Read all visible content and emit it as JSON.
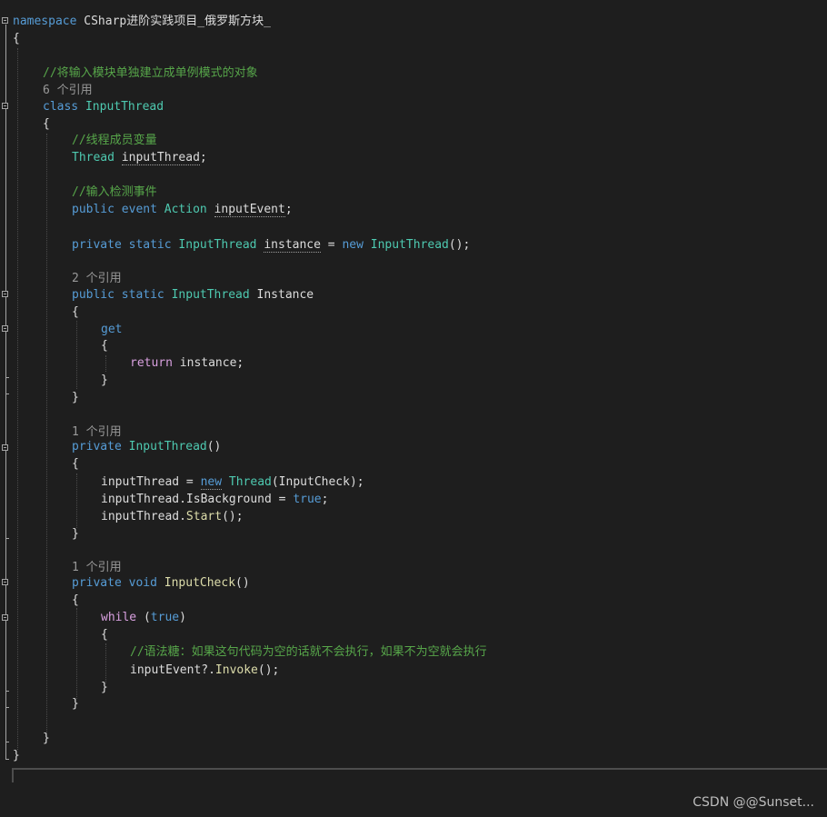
{
  "code": {
    "l1": {
      "kw": "namespace",
      "name": " CSharp进阶实践项目_俄罗斯方块_"
    },
    "l2": "{",
    "l4": "//将输入模块单独建立成单例模式的对象",
    "l5": "6 个引用",
    "l6": {
      "kw": "class",
      "name": " InputThread"
    },
    "l7": "{",
    "l8": "//线程成员变量",
    "l9": {
      "type": "Thread",
      "sp": " ",
      "var": "inputThread",
      "end": ";"
    },
    "l11": "//输入检测事件",
    "l12": {
      "kw1": "public",
      "kw2": " event",
      "type": " Action",
      "sp": " ",
      "var": "inputEvent",
      "end": ";"
    },
    "l14": {
      "kw1": "private",
      "kw2": " static",
      "type": " InputThread",
      "sp": " ",
      "var": "instance",
      "eq": " = ",
      "kwnew": "new",
      "type2": " InputThread",
      "end": "();"
    },
    "l16": "2 个引用",
    "l17": {
      "kw1": "public",
      "kw2": " static",
      "type": " InputThread",
      "name": " Instance"
    },
    "l18": "{",
    "l19": "get",
    "l20": "{",
    "l21": {
      "kw": "return",
      "rest": " instance;"
    },
    "l22": "}",
    "l23": "}",
    "l25": "1 个引用",
    "l26": {
      "kw": "private",
      "type": " InputThread",
      "end": "()"
    },
    "l27": "{",
    "l28": {
      "a": "inputThread = ",
      "kwnew": "new",
      "type": " Thread",
      "b": "(InputCheck);"
    },
    "l29": {
      "a": "inputThread.IsBackground = ",
      "kwtrue": "true",
      "b": ";"
    },
    "l30": {
      "a": "inputThread.",
      "mth": "Start",
      "b": "();"
    },
    "l31": "}",
    "l33": "1 个引用",
    "l34": {
      "kw1": "private",
      "kw2": " void",
      "mth": " InputCheck",
      "end": "()"
    },
    "l35": "{",
    "l36": {
      "kw": "while",
      "a": " (",
      "kwtrue": "true",
      "b": ")"
    },
    "l37": "{",
    "l38": "//语法糖：如果这句代码为空的话就不会执行，如果不为空就会执行",
    "l39": {
      "a": "inputEvent?.",
      "mth": "Invoke",
      "b": "();"
    },
    "l40": "}",
    "l41": "}",
    "l43": "}",
    "l44": "}"
  },
  "watermark": "CSDN @@Sunset..."
}
